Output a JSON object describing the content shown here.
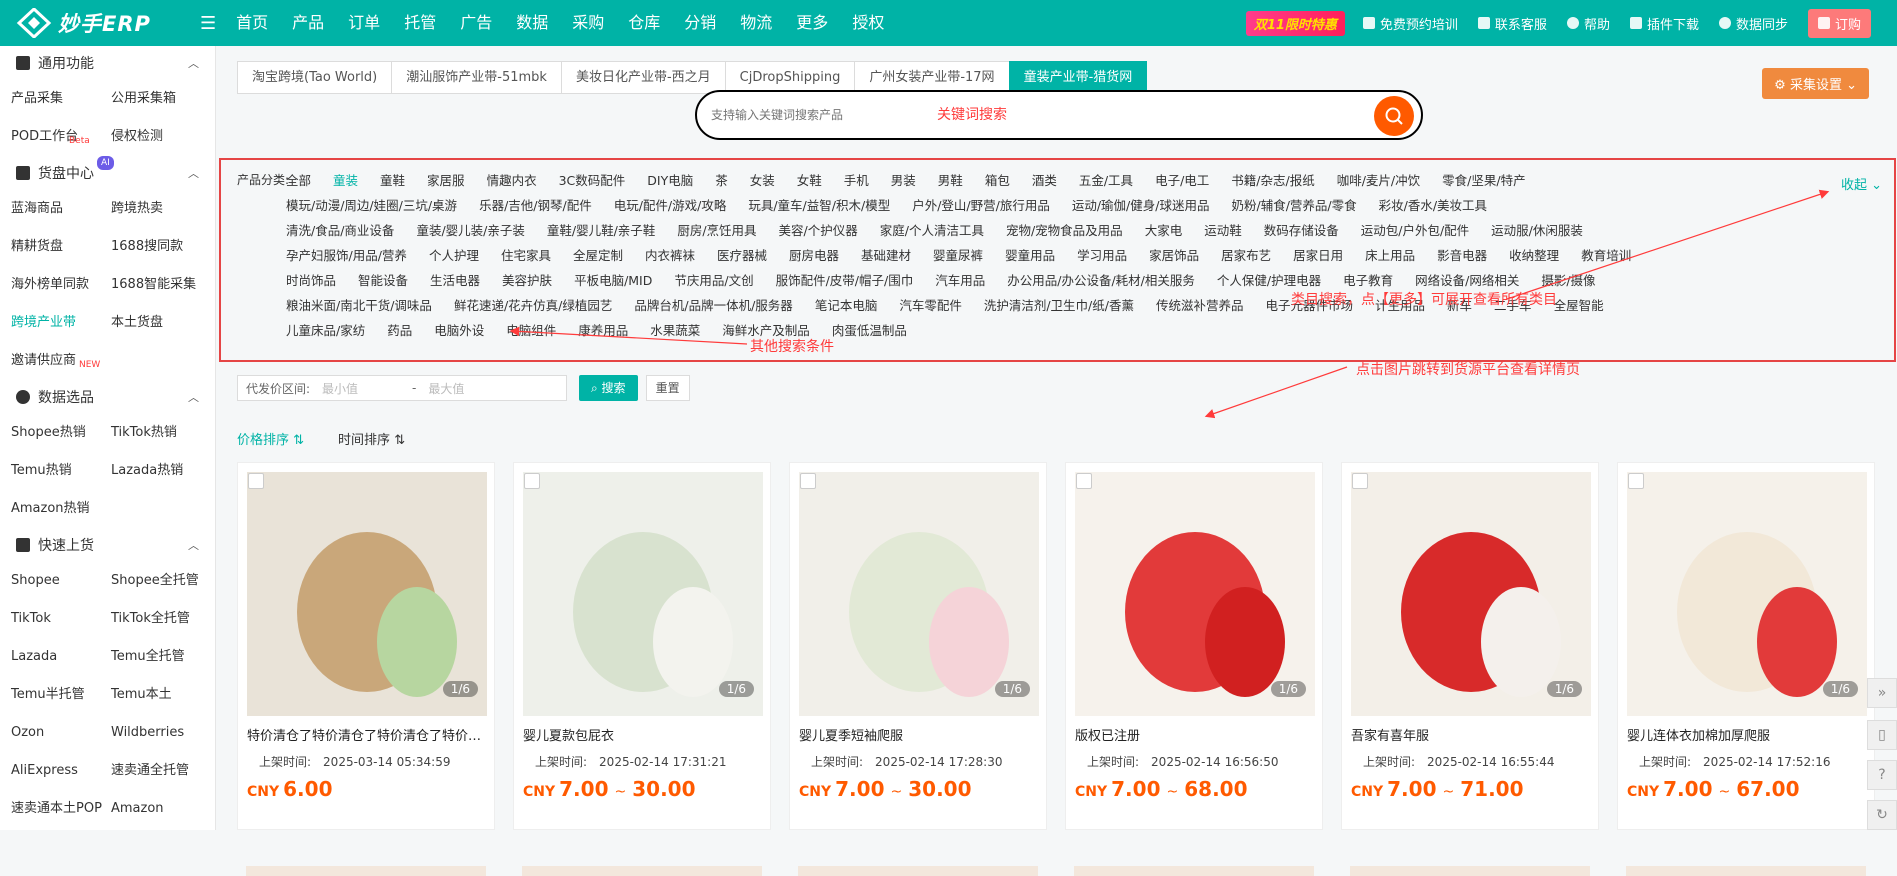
{
  "app": {
    "logo_text": "妙手ERP"
  },
  "nav": [
    {
      "label": "首页"
    },
    {
      "label": "产品"
    },
    {
      "label": "订单",
      "dot": true
    },
    {
      "label": "托管"
    },
    {
      "label": "广告"
    },
    {
      "label": "数据"
    },
    {
      "label": "采购",
      "dot": true
    },
    {
      "label": "仓库",
      "dot": true
    },
    {
      "label": "分销"
    },
    {
      "label": "物流"
    },
    {
      "label": "更多"
    },
    {
      "label": "授权"
    }
  ],
  "topright": {
    "promo": "双11限时特惠",
    "training": "免费预约培训",
    "service": "联系客服",
    "help": "帮助",
    "plugin": "插件下载",
    "sync": "数据同步",
    "order": "订购"
  },
  "sidebar": {
    "general": {
      "title": "通用功能",
      "items": [
        "产品采集",
        "公用采集箱",
        "POD工作台",
        "侵权检测"
      ],
      "beta": "Beta"
    },
    "sourcing": {
      "title": "货盘中心",
      "ai": "AI",
      "items": [
        "蓝海商品",
        "跨境热卖",
        "精耕货盘",
        "1688搜同款",
        "海外榜单同款",
        "1688智能采集",
        "跨境产业带",
        "本土货盘",
        "邀请供应商"
      ],
      "new": "NEW"
    },
    "selection": {
      "title": "数据选品",
      "items": [
        "Shopee热销",
        "TikTok热销",
        "Temu热销",
        "Lazada热销",
        "Amazon热销"
      ]
    },
    "quick": {
      "title": "快速上货",
      "items": [
        "Shopee",
        "Shopee全托管",
        "TikTok",
        "TikTok全托管",
        "Lazada",
        "Temu全托管",
        "Temu半托管",
        "Temu本土",
        "Ozon",
        "Wildberries",
        "AliExpress",
        "速卖通全托管",
        "速卖通本土POP",
        "Amazon"
      ]
    }
  },
  "store_tabs": [
    "淘宝跨境(Tao World)",
    "潮汕服饰产业带-51mbk",
    "美妆日化产业带-西之月",
    "CjDropShipping",
    "广州女装产业带-17网",
    "童装产业带-猎货网"
  ],
  "collect_settings": "采集设置",
  "search": {
    "placeholder": "支持输入关键词搜索产品"
  },
  "annotations": {
    "keyword": "关键词搜索",
    "category": "类目搜索，点【更多】可展开查看所有类目",
    "other": "其他搜索条件",
    "image": "点击图片跳转到货源平台查看详情页"
  },
  "categories": {
    "label": "产品分类:",
    "collapse": "收起",
    "rows": [
      [
        "全部",
        "童装",
        "童鞋",
        "家居服",
        "情趣内衣",
        "3C数码配件",
        "DIY电脑",
        "茶",
        "女装",
        "女鞋",
        "手机",
        "男装",
        "男鞋",
        "箱包",
        "酒类",
        "五金/工具",
        "电子/电工",
        "书籍/杂志/报纸",
        "咖啡/麦片/冲饮",
        "零食/坚果/特产"
      ],
      [
        "模玩/动漫/周边/娃圈/三坑/桌游",
        "乐器/吉他/钢琴/配件",
        "电玩/配件/游戏/攻略",
        "玩具/童车/益智/积木/模型",
        "户外/登山/野营/旅行用品",
        "运动/瑜伽/健身/球迷用品",
        "奶粉/辅食/营养品/零食",
        "彩妆/香水/美妆工具"
      ],
      [
        "清洗/食品/商业设备",
        "童装/婴儿装/亲子装",
        "童鞋/婴儿鞋/亲子鞋",
        "厨房/烹饪用具",
        "美容/个护仪器",
        "家庭/个人清洁工具",
        "宠物/宠物食品及用品",
        "大家电",
        "运动鞋",
        "数码存储设备",
        "运动包/户外包/配件",
        "运动服/休闲服装"
      ],
      [
        "孕产妇服饰/用品/营养",
        "个人护理",
        "住宅家具",
        "全屋定制",
        "内衣裤袜",
        "医疗器械",
        "厨房电器",
        "基础建材",
        "婴童尿裤",
        "婴童用品",
        "学习用品",
        "家居饰品",
        "居家布艺",
        "居家日用",
        "床上用品",
        "影音电器",
        "收纳整理",
        "教育培训"
      ],
      [
        "时尚饰品",
        "智能设备",
        "生活电器",
        "美容护肤",
        "平板电脑/MID",
        "节庆用品/文创",
        "服饰配件/皮带/帽子/围巾",
        "汽车用品",
        "办公用品/办公设备/耗材/相关服务",
        "个人保健/护理电器",
        "电子教育",
        "网络设备/网络相关",
        "摄影/摄像"
      ],
      [
        "粮油米面/南北干货/调味品",
        "鲜花速递/花卉仿真/绿植园艺",
        "品牌台机/品牌一体机/服务器",
        "笔记本电脑",
        "汽车零配件",
        "洗护清洁剂/卫生巾/纸/香薰",
        "传统滋补营养品",
        "电子元器件市场",
        "计生用品",
        "新车",
        "二手车",
        "全屋智能"
      ],
      [
        "儿童床品/家纺",
        "药品",
        "电脑外设",
        "电脑组件",
        "康养用品",
        "水果蔬菜",
        "海鲜水产及制品",
        "肉蛋低温制品"
      ]
    ]
  },
  "filters": {
    "price_label": "代发价区间:",
    "min": "最小值",
    "sep": "-",
    "max": "最大值",
    "search_btn": "搜索",
    "reset_btn": "重置"
  },
  "sort": {
    "price": "价格排序",
    "time": "时间排序"
  },
  "products": [
    {
      "title": "特价清仓了特价清仓了特价清仓了特价清仓了",
      "time_label": "上架时间:",
      "time": "2025-03-14 05:34:59",
      "cny": "CNY",
      "price": "6.00",
      "price_max": "",
      "count": "1/6"
    },
    {
      "title": "婴儿夏款包屁衣",
      "time_label": "上架时间:",
      "time": "2025-02-14 17:31:21",
      "cny": "CNY",
      "price": "7.00",
      "sep": "~",
      "price_max": "30.00",
      "count": "1/6"
    },
    {
      "title": "婴儿夏季短袖爬服",
      "time_label": "上架时间:",
      "time": "2025-02-14 17:28:30",
      "cny": "CNY",
      "price": "7.00",
      "sep": "~",
      "price_max": "30.00",
      "count": "1/6"
    },
    {
      "title": "版权已注册",
      "time_label": "上架时间:",
      "time": "2025-02-14 16:56:50",
      "cny": "CNY",
      "price": "7.00",
      "sep": "~",
      "price_max": "68.00",
      "count": "1/6"
    },
    {
      "title": "吾家有喜年服",
      "time_label": "上架时间:",
      "time": "2025-02-14 16:55:44",
      "cny": "CNY",
      "price": "7.00",
      "sep": "~",
      "price_max": "71.00",
      "count": "1/6"
    },
    {
      "title": "婴儿连体衣加棉加厚爬服",
      "time_label": "上架时间:",
      "time": "2025-02-14 17:52:16",
      "cny": "CNY",
      "price": "7.00",
      "sep": "~",
      "price_max": "67.00",
      "count": "1/6"
    }
  ],
  "colors": {
    "teal": "#00b3a6",
    "accent": "#ff5a00",
    "annotation": "#ff3b3b"
  }
}
